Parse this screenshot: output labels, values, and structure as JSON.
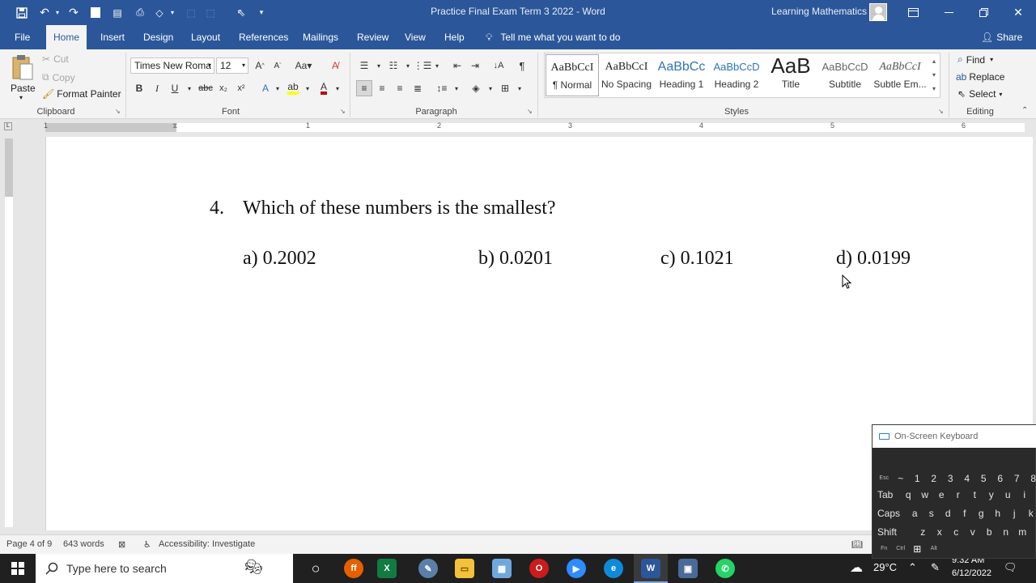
{
  "window": {
    "title": "Practice Final Exam Term 3 2022  -  Word",
    "user": "Learning Mathematics"
  },
  "tabs": [
    "File",
    "Home",
    "Insert",
    "Design",
    "Layout",
    "References",
    "Mailings",
    "Review",
    "View",
    "Help"
  ],
  "tell_me": "Tell me what you want to do",
  "share": "Share",
  "ribbon": {
    "clipboard": {
      "paste": "Paste",
      "cut": "Cut",
      "copy": "Copy",
      "format_painter": "Format Painter",
      "label": "Clipboard"
    },
    "font": {
      "name": "Times New Roma",
      "size": "12",
      "label": "Font"
    },
    "paragraph": {
      "label": "Paragraph"
    },
    "styles": {
      "items": [
        {
          "sample": "AaBbCcI",
          "name": "¶ Normal"
        },
        {
          "sample": "AaBbCcI",
          "name": "No Spacing"
        },
        {
          "sample": "AaBbCc",
          "name": "Heading 1"
        },
        {
          "sample": "AaBbCcD",
          "name": "Heading 2"
        },
        {
          "sample": "AaB",
          "name": "Title"
        },
        {
          "sample": "AaBbCcD",
          "name": "Subtitle"
        },
        {
          "sample": "AaBbCcI",
          "name": "Subtle Em..."
        }
      ],
      "label": "Styles"
    },
    "editing": {
      "find": "Find",
      "replace": "Replace",
      "select": "Select",
      "label": "Editing"
    }
  },
  "ruler_numbers": [
    "1",
    "1",
    "2",
    "3",
    "4",
    "5",
    "6"
  ],
  "document": {
    "question_number": "4.",
    "question": "Which of these numbers is the smallest?",
    "options": [
      "a) 0.2002",
      "b) 0.0201",
      "c) 0.1021",
      "d) 0.0199"
    ]
  },
  "status": {
    "page": "Page 4 of 9",
    "words": "643 words",
    "accessibility": "Accessibility: Investigate"
  },
  "taskbar": {
    "search_placeholder": "Type here to search",
    "weather": "29°C",
    "time": "9:32 AM",
    "date": "6/12/2022"
  },
  "osk": {
    "title": "On-Screen Keyboard",
    "rows": [
      [
        "Esc",
        "~",
        "1",
        "2",
        "3",
        "4",
        "5",
        "6",
        "7",
        "8"
      ],
      [
        "Tab",
        "q",
        "w",
        "e",
        "r",
        "t",
        "y",
        "u",
        "i"
      ],
      [
        "Caps",
        "a",
        "s",
        "d",
        "f",
        "g",
        "h",
        "j",
        "k"
      ],
      [
        "Shift",
        "z",
        "x",
        "c",
        "v",
        "b",
        "n",
        "m"
      ],
      [
        "Fn",
        "Ctrl",
        "",
        "Alt"
      ]
    ]
  },
  "colors": {
    "word_blue": "#2b579a",
    "ribbon_bg": "#f3f3f3",
    "taskbar_bg": "#202020"
  }
}
